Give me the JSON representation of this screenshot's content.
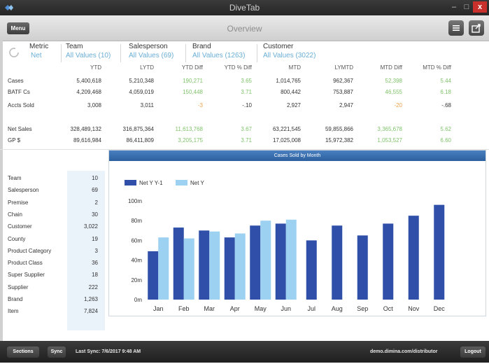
{
  "window": {
    "title": "DiveTab",
    "minimize": "‒",
    "maximize": "□",
    "close": "x"
  },
  "toolbar": {
    "menu_label": "Menu",
    "page_title": "Overview"
  },
  "filters": [
    {
      "label": "Metric",
      "value": "Net"
    },
    {
      "label": "Team",
      "value": "All Values (10)"
    },
    {
      "label": "Salesperson",
      "value": "All Values (69)"
    },
    {
      "label": "Brand",
      "value": "All Values (1263)"
    },
    {
      "label": "Customer",
      "value": "All Values (3022)"
    }
  ],
  "metrics": {
    "columns": [
      "YTD",
      "LYTD",
      "YTD Diff",
      "YTD % Diff",
      "MTD",
      "LYMTD",
      "MTD Diff",
      "MTD % Diff"
    ],
    "rows": [
      {
        "label": "Cases",
        "values": [
          "5,400,618",
          "5,210,348",
          "190,271",
          "3.65",
          "1,014,765",
          "962,367",
          "52,398",
          "5.44"
        ],
        "signs": [
          "",
          "",
          "pos",
          "pos",
          "",
          "",
          "pos",
          "pos"
        ]
      },
      {
        "label": "BATF Cs",
        "values": [
          "4,209,468",
          "4,059,019",
          "150,448",
          "3.71",
          "800,442",
          "753,887",
          "46,555",
          "6.18"
        ],
        "signs": [
          "",
          "",
          "pos",
          "pos",
          "",
          "",
          "pos",
          "pos"
        ]
      },
      {
        "label": "Accts Sold",
        "values": [
          "3,008",
          "3,011",
          "-3",
          "-.10",
          "2,927",
          "2,947",
          "-20",
          "-.68"
        ],
        "signs": [
          "",
          "",
          "neg",
          "",
          "",
          "",
          "neg",
          ""
        ]
      },
      {
        "label": "Net Sales",
        "values": [
          "328,489,132",
          "316,875,364",
          "11,613,768",
          "3.67",
          "63,221,545",
          "59,855,866",
          "3,365,678",
          "5.62"
        ],
        "signs": [
          "",
          "",
          "pos",
          "pos",
          "",
          "",
          "pos",
          "pos"
        ]
      },
      {
        "label": "GP $",
        "values": [
          "89,616,984",
          "86,411,809",
          "3,205,175",
          "3.71",
          "17,025,008",
          "15,972,382",
          "1,053,527",
          "6.60"
        ],
        "signs": [
          "",
          "",
          "pos",
          "pos",
          "",
          "",
          "pos",
          "pos"
        ]
      }
    ]
  },
  "dimensions": [
    {
      "label": "Team",
      "value": "10"
    },
    {
      "label": "Salesperson",
      "value": "69"
    },
    {
      "label": "Premise",
      "value": "2"
    },
    {
      "label": "Chain",
      "value": "30"
    },
    {
      "label": "Customer",
      "value": "3,022"
    },
    {
      "label": "County",
      "value": "19"
    },
    {
      "label": "Product Category",
      "value": "3"
    },
    {
      "label": "Product Class",
      "value": "36"
    },
    {
      "label": "Super Supplier",
      "value": "18"
    },
    {
      "label": "Supplier",
      "value": "222"
    },
    {
      "label": "Brand",
      "value": "1,263"
    },
    {
      "label": "Item",
      "value": "7,824"
    }
  ],
  "chart_data": {
    "type": "bar",
    "title": "Cases Sold by Month",
    "categories": [
      "Jan",
      "Feb",
      "Mar",
      "Apr",
      "May",
      "Jun",
      "Jul",
      "Aug",
      "Sep",
      "Oct",
      "Nov",
      "Dec"
    ],
    "series": [
      {
        "name": "Net Y Y-1",
        "color": "#2f4fa8",
        "values": [
          49,
          73,
          70,
          63,
          75,
          77,
          60,
          75,
          65,
          77,
          85,
          96
        ]
      },
      {
        "name": "Net Y",
        "color": "#9dd1f2",
        "values": [
          63,
          62,
          69,
          67,
          80,
          81,
          null,
          null,
          null,
          null,
          null,
          null
        ]
      }
    ],
    "yticks": [
      "0m",
      "20m",
      "40m",
      "60m",
      "80m",
      "100m"
    ],
    "ylim": [
      0,
      100
    ],
    "grid": false,
    "legend": "top-left"
  },
  "bottombar": {
    "sections_label": "Sections",
    "sync_label": "Sync",
    "last_sync": "Last Sync: 7/6/2017 9:48 AM",
    "server": "demo.dimina.com/distributor",
    "logout_label": "Logout"
  }
}
